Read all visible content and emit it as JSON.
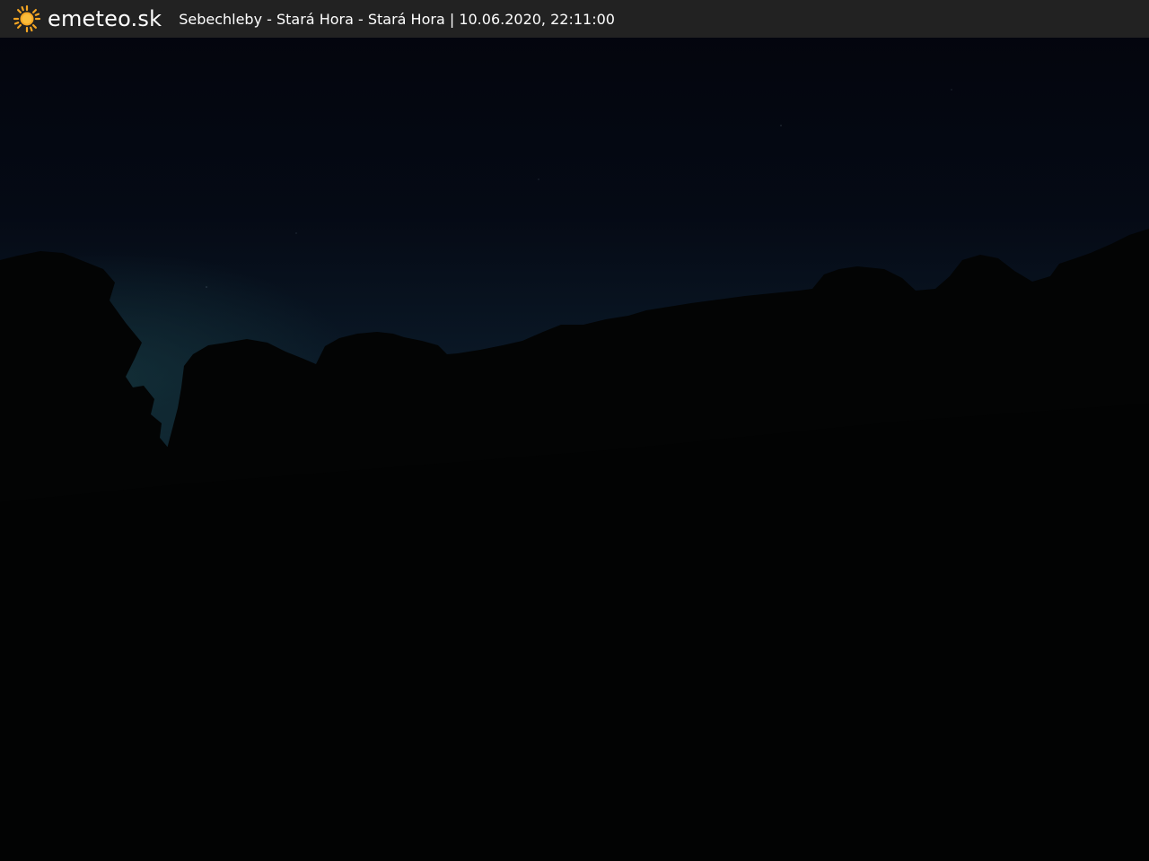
{
  "header": {
    "brand": "emeteo.sk",
    "logo_icon": "sun-icon",
    "location": "Sebechleby - Stará Hora - Stará Hora",
    "separator": " | ",
    "timestamp": "10.06.2020, 22:11:00"
  },
  "colors": {
    "header_background": "#222222",
    "logo_sun": "#f5a623",
    "text": "#ffffff"
  }
}
